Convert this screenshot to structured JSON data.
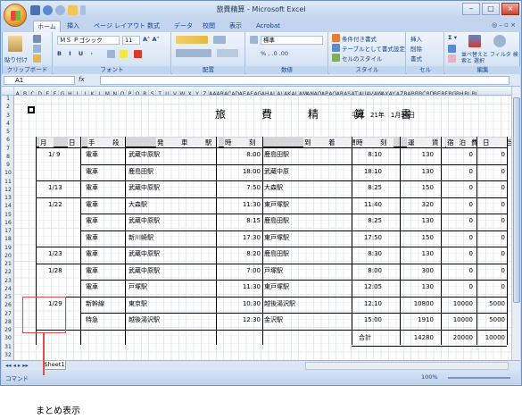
{
  "window": {
    "title": "旅費精算 - Microsoft Excel",
    "controls": [
      "–",
      "□",
      "×"
    ]
  },
  "tabs": [
    "ホーム",
    "挿入",
    "ページ レイアウト",
    "数式",
    "データ",
    "校閲",
    "表示",
    "Acrobat"
  ],
  "ribbon": {
    "clipboard": {
      "paste": "貼り付け",
      "label": "クリップボード"
    },
    "font": {
      "name": "ＭＳ Ｐゴシック",
      "size": "11",
      "label": "フォント"
    },
    "alignment": {
      "label": "配置"
    },
    "number": {
      "format": "標準",
      "label": "数値"
    },
    "style": {
      "conditional": "条件付き書式",
      "table": "テーブルとして書式設定",
      "cellstyle": "セルのスタイル",
      "label": "スタイル"
    },
    "cells": {
      "insert": "挿入",
      "delete": "削除",
      "format": "書式",
      "label": "セル"
    },
    "editing": {
      "sort": "並べ替えと フィルタ",
      "find": "検索と 選択",
      "label": "編集"
    }
  },
  "formula_bar": {
    "name_box": "A1",
    "fx": "fx",
    "content": ""
  },
  "sheet": {
    "title": "旅　費　精　算　書",
    "date": "平成　21年　1月30日",
    "headers": [
      "月",
      "日",
      "手　段",
      "発　車　駅",
      "時　刻",
      "到　着　駅",
      "時　刻",
      "運　賃",
      "宿泊費",
      "日　当"
    ],
    "rows": [
      {
        "date": "1/ 9",
        "mode": "電車",
        "from": "武蔵中原駅",
        "dep": "8:00",
        "to": "鹿島田駅",
        "arr": "8:10",
        "fare": "130",
        "lodging": "0",
        "allowance": "0"
      },
      {
        "date": "",
        "mode": "電車",
        "from": "鹿島田駅",
        "dep": "18:00",
        "to": "武蔵中原",
        "arr": "18:10",
        "fare": "130",
        "lodging": "0",
        "allowance": "0"
      },
      {
        "date": "1/13",
        "mode": "電車",
        "from": "武蔵中原駅",
        "dep": "7:50",
        "to": "大森駅",
        "arr": "8:25",
        "fare": "150",
        "lodging": "0",
        "allowance": "0"
      },
      {
        "date": "1/22",
        "mode": "電車",
        "from": "大森駅",
        "dep": "11:30",
        "to": "東戸塚駅",
        "arr": "11:40",
        "fare": "320",
        "lodging": "0",
        "allowance": "0"
      },
      {
        "date": "",
        "mode": "電車",
        "from": "武蔵中原駅",
        "dep": "8:15",
        "to": "鹿島田駅",
        "arr": "8:25",
        "fare": "130",
        "lodging": "0",
        "allowance": "0"
      },
      {
        "date": "",
        "mode": "電車",
        "from": "新川崎駅",
        "dep": "17:30",
        "to": "東戸塚駅",
        "arr": "17:50",
        "fare": "150",
        "lodging": "0",
        "allowance": "0"
      },
      {
        "date": "1/23",
        "mode": "電車",
        "from": "武蔵中原駅",
        "dep": "8:20",
        "to": "鹿島田駅",
        "arr": "8:30",
        "fare": "130",
        "lodging": "0",
        "allowance": "0"
      },
      {
        "date": "1/28",
        "mode": "電車",
        "from": "武蔵中原駅",
        "dep": "7:00",
        "to": "戸塚駅",
        "arr": "8:00",
        "fare": "300",
        "lodging": "0",
        "allowance": "0"
      },
      {
        "date": "",
        "mode": "電車",
        "from": "戸塚駅",
        "dep": "11:30",
        "to": "東戸塚駅",
        "arr": "12:05",
        "fare": "130",
        "lodging": "0",
        "allowance": "0"
      },
      {
        "date": "1/29",
        "mode": "新幹線",
        "from": "東京駅",
        "dep": "10:30",
        "to": "越後湯沢駅",
        "arr": "12:10",
        "fare": "10800",
        "lodging": "10000",
        "allowance": "5000"
      },
      {
        "date": "",
        "mode": "特急",
        "from": "越後湯沢駅",
        "dep": "12:30",
        "to": "金沢駅",
        "arr": "15:00",
        "fare": "1910",
        "lodging": "10000",
        "allowance": "5000"
      }
    ],
    "total": {
      "label": "合計",
      "fare": "14280",
      "lodging": "20000",
      "allowance": "10000"
    }
  },
  "sheet_tab": "Sheet1",
  "status": {
    "mode": "コマンド",
    "zoom": "100%"
  },
  "annotation": {
    "label": "まとめ表示"
  },
  "colors": {
    "annotation": "#e64b4b",
    "ribbon": "#c3d5ee"
  }
}
